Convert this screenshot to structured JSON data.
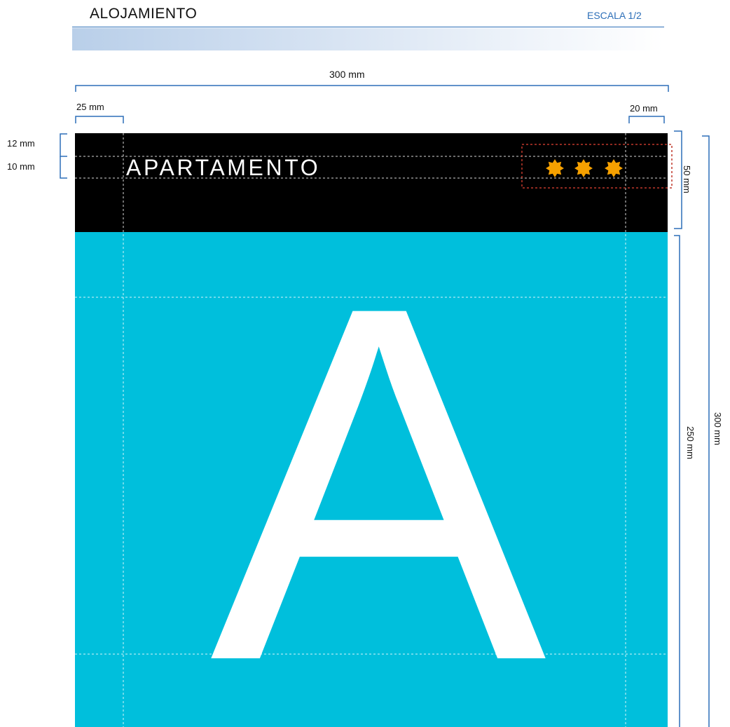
{
  "header": {
    "title": "ALOJAMIENTO",
    "scale": "ESCALA 1/2"
  },
  "dimensions": {
    "total_width": "300 mm",
    "left_margin": "25 mm",
    "right_margin": "20 mm",
    "top_offset": "12 mm",
    "text_height": "10 mm",
    "band_height": "50 mm",
    "body_height": "250 mm",
    "total_height": "300 mm"
  },
  "sign": {
    "band_text": "APARTAMENTO",
    "letter": "A",
    "star_count": 3,
    "colors": {
      "band": "#000000",
      "body": "#00bfdc",
      "text": "#ffffff",
      "stars": "#f5a000",
      "guides": "#ffffff",
      "star_box": "#c0392b",
      "dimension_lines": "#2d6fb8"
    }
  }
}
